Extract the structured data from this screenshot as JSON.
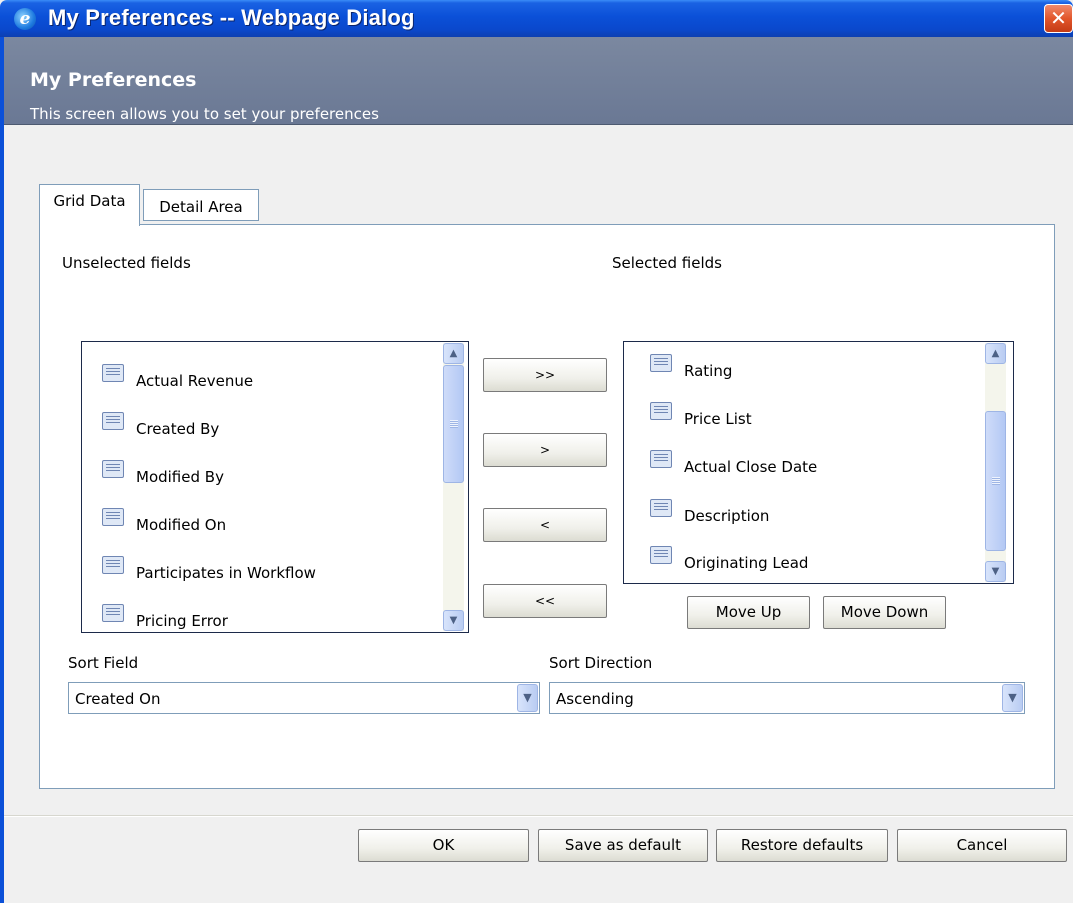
{
  "window": {
    "title": "My Preferences -- Webpage Dialog",
    "close_glyph": "✕"
  },
  "header": {
    "title": "My Preferences",
    "subtitle": "This screen allows you to set your preferences"
  },
  "tabs": [
    {
      "label": "Grid Data",
      "active": true
    },
    {
      "label": "Detail Area",
      "active": false
    }
  ],
  "unselected": {
    "label": "Unselected fields",
    "items": [
      "Actual Revenue",
      "Created By",
      "Modified By",
      "Modified On",
      "Participates in Workflow",
      "Pricing Error"
    ]
  },
  "selected": {
    "label": "Selected fields",
    "items": [
      "Rating",
      "Price List",
      "Actual Close Date",
      "Description",
      "Originating Lead"
    ]
  },
  "transfer_buttons": {
    "add_all": ">>",
    "add": ">",
    "remove": "<",
    "remove_all": "<<"
  },
  "order_buttons": {
    "move_up": "Move Up",
    "move_down": "Move Down"
  },
  "sort": {
    "field_label": "Sort Field",
    "field_value": "Created On",
    "direction_label": "Sort Direction",
    "direction_value": "Ascending"
  },
  "footer": {
    "ok": "OK",
    "save_default": "Save as default",
    "restore_defaults": "Restore defaults",
    "cancel": "Cancel"
  },
  "icons": {
    "scroll_up": "▲",
    "scroll_down": "▼",
    "dropdown": "▼"
  },
  "colors": {
    "titlebar": "#0b50d8",
    "header_band": "#6a7894",
    "panel_border": "#7f9db9"
  }
}
